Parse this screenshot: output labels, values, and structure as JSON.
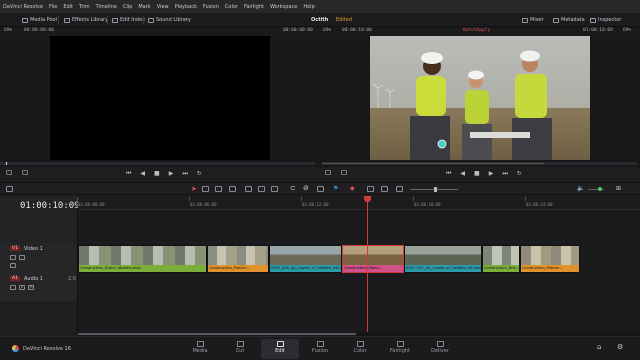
{
  "menubar": [
    "DaVinci Resolve",
    "File",
    "Edit",
    "Trim",
    "Timeline",
    "Clip",
    "Mark",
    "View",
    "Playback",
    "Fusion",
    "Color",
    "Fairlight",
    "Workspace",
    "Help"
  ],
  "toolbar": {
    "media_pool": "Media Pool",
    "effects_library": "Effects Library",
    "edit_index": "Edit Index",
    "sound_library": "Sound Library",
    "project_title": "Octith",
    "project_status": "Edited",
    "mixer": "Mixer",
    "metadata": "Metadata",
    "inspector": "Inspector"
  },
  "viewer_header": {
    "source_zoom": "69%",
    "source_tc_left": "00:00:00:00",
    "source_tc_right": "00:00:00:00",
    "timeline_zoom": "69%",
    "timeline_tc_left": "00:00:10:00",
    "timeline_name": "BatchApply",
    "timeline_tc_right": "01:00:10:09",
    "timeline_zoom_right": "69%"
  },
  "timeline": {
    "timecode": "01:00:10:09",
    "ruler": [
      "01:00:00:00",
      "01:00:06:00",
      "01:00:12:00",
      "01:00:18:00",
      "01:00:24:00"
    ]
  },
  "tracks": {
    "video": {
      "id": "V1",
      "name": "Video 1"
    },
    "audio": {
      "id": "A1",
      "name": "Audio 1",
      "channels": "2.0"
    }
  },
  "clips": [
    {
      "label": "Construction_Drone_Workers.mov",
      "color": "#7cae3c"
    },
    {
      "label": "Construction_Plancin...",
      "color": "#e0922e"
    },
    {
      "label": "0307_016_4()_inspire_x7_rawfilm_h4.mov",
      "color": "#2c9aa8"
    },
    {
      "label": "Construction_Plane...",
      "color": "#d0508a"
    },
    {
      "label": "0307_017_4()_inspire_x7_rawfilm_h4.mov",
      "color": "#2c9aa8"
    },
    {
      "label": "Construction_Bris...",
      "color": "#7cae3c"
    },
    {
      "label": "Construction_Plancin...",
      "color": "#e0922e"
    }
  ],
  "pages": [
    "Media",
    "Cut",
    "Edit",
    "Fusion",
    "Color",
    "Fairlight",
    "Deliver"
  ],
  "active_page": "Edit",
  "brand": "DaVinci Resolve 16"
}
